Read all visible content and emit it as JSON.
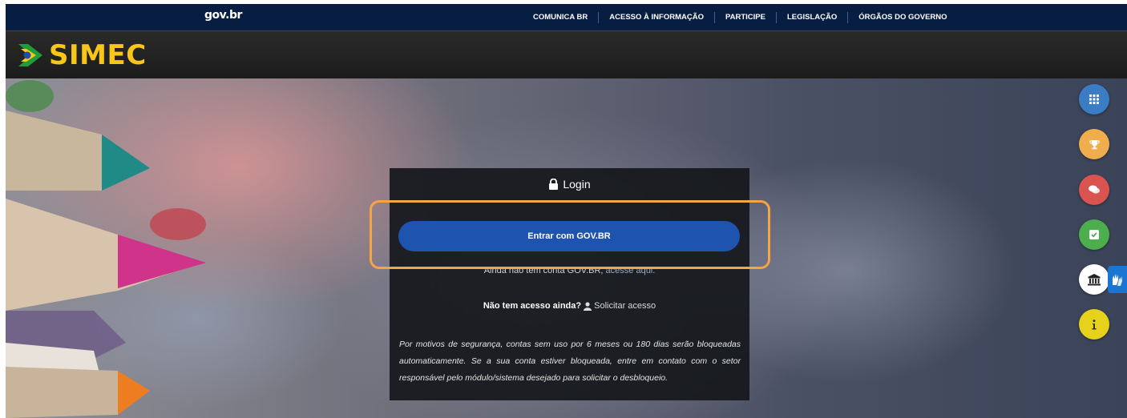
{
  "govbar": {
    "logo": "gov.br",
    "nav": [
      "COMUNICA BR",
      "ACESSO À INFORMAÇÃO",
      "PARTICIPE",
      "LEGISLAÇÃO",
      "ÓRGÃOS DO GOVERNO"
    ]
  },
  "header": {
    "app_name": "SIMEC"
  },
  "login": {
    "title": "Login",
    "gov_button": "Entrar com  GOV.BR",
    "no_account_text": "Ainda não tem conta GOV.BR,",
    "no_account_link": "acesse aqui.",
    "no_access_label": "Não tem acesso ainda?",
    "request_access": "Solicitar acesso",
    "notice": "Por motivos de segurança, contas sem uso por 6 meses ou 180 dias serão bloqueadas automaticamente. Se a sua conta estiver bloqueada, entre em contato com o setor responsável pelo módulo/sistema desejado para solicitar o desbloqueio."
  },
  "side_buttons": [
    {
      "icon": "grid-icon",
      "color": "#3b7dc4"
    },
    {
      "icon": "trophy-icon",
      "color": "#f0ad4e"
    },
    {
      "icon": "chat-icon",
      "color": "#d9534f"
    },
    {
      "icon": "check-square-icon",
      "color": "#4cae4c"
    },
    {
      "icon": "institution-icon",
      "color": "#ffffff"
    },
    {
      "icon": "info-icon",
      "color": "#e6d21a"
    }
  ],
  "colors": {
    "govbar_bg": "#071d41",
    "gov_button": "#1e54b0",
    "highlight": "#f5a544",
    "logo_yellow": "#f6c718"
  }
}
